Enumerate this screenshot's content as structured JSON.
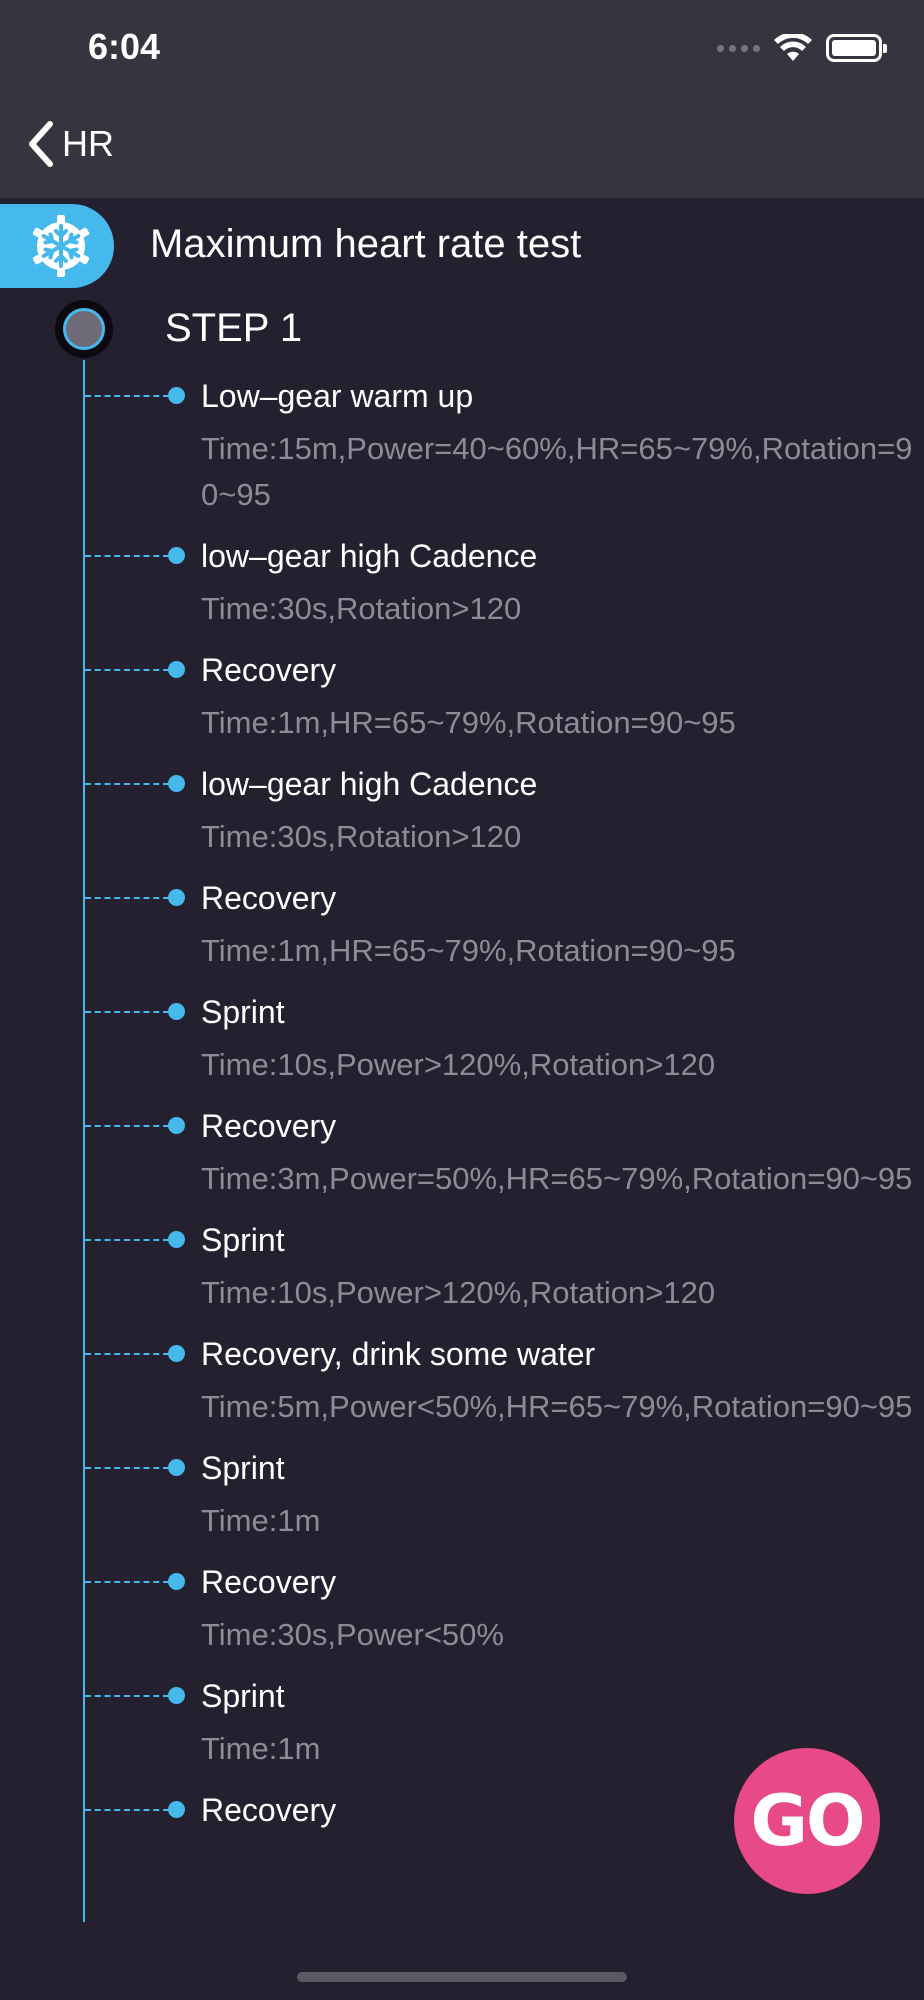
{
  "status_bar": {
    "time": "6:04"
  },
  "nav": {
    "back_label": "HR"
  },
  "test": {
    "title": "Maximum heart rate test",
    "step_label": "STEP 1"
  },
  "steps": [
    {
      "name": "Low–gear warm up",
      "detail": "Time:15m,Power=40~60%,HR=65~79%,Rotation=90~95"
    },
    {
      "name": "low–gear high Cadence",
      "detail": "Time:30s,Rotation>120"
    },
    {
      "name": "Recovery",
      "detail": "Time:1m,HR=65~79%,Rotation=90~95"
    },
    {
      "name": "low–gear high Cadence",
      "detail": "Time:30s,Rotation>120"
    },
    {
      "name": "Recovery",
      "detail": "Time:1m,HR=65~79%,Rotation=90~95"
    },
    {
      "name": "Sprint",
      "detail": "Time:10s,Power>120%,Rotation>120"
    },
    {
      "name": "Recovery",
      "detail": "Time:3m,Power=50%,HR=65~79%,Rotation=90~95"
    },
    {
      "name": "Sprint",
      "detail": "Time:10s,Power>120%,Rotation>120"
    },
    {
      "name": "Recovery, drink some water",
      "detail": "Time:5m,Power<50%,HR=65~79%,Rotation=90~95"
    },
    {
      "name": "Sprint",
      "detail": "Time:1m"
    },
    {
      "name": "Recovery",
      "detail": "Time:30s,Power<50%"
    },
    {
      "name": "Sprint",
      "detail": "Time:1m"
    },
    {
      "name": "Recovery",
      "detail": ""
    }
  ],
  "actions": {
    "go_label": "GO"
  },
  "colors": {
    "accent": "#45b8ec",
    "go": "#e84a88",
    "background": "#242030",
    "header": "#37333f"
  }
}
